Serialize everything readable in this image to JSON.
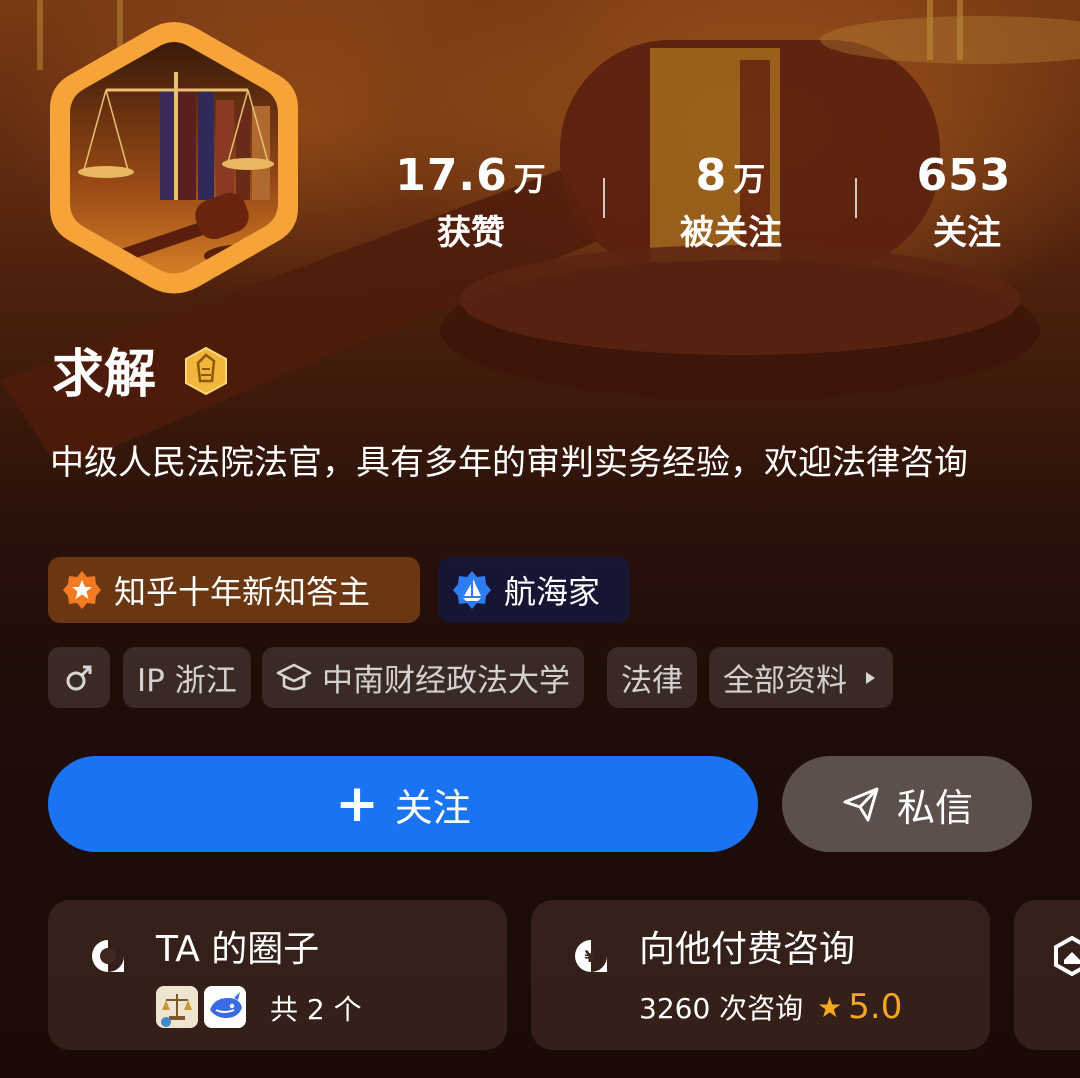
{
  "profile": {
    "name": "求解",
    "bio": "中级人民法院法官，具有多年的审判实务经验，欢迎法律咨询"
  },
  "stats": [
    {
      "value": "17.6",
      "unit": "万",
      "label": "获赞"
    },
    {
      "value": "8",
      "unit": "万",
      "label": "被关注"
    },
    {
      "value": "653",
      "unit": "",
      "label": "关注"
    }
  ],
  "honors": [
    {
      "label": "知乎十年新知答主",
      "icon": "star-badge-icon"
    },
    {
      "label": "航海家",
      "icon": "sailboat-icon"
    }
  ],
  "chips": {
    "gender_icon": "male-icon",
    "ip": "IP 浙江",
    "school": "中南财经政法大学",
    "field": "法律",
    "all_info": "全部资料"
  },
  "actions": {
    "follow": "关注",
    "message": "私信"
  },
  "cards": {
    "circle": {
      "title": "TA 的圈子",
      "count": "共 2 个"
    },
    "consult": {
      "title": "向他付费咨询",
      "count": "3260 次咨询",
      "rating": "5.0"
    }
  },
  "colors": {
    "primary_blue": "#1a73f0",
    "rating_star": "#f5a623",
    "avatar_frame": "#f6a33a"
  }
}
